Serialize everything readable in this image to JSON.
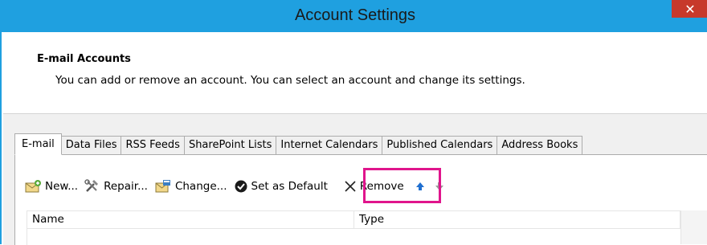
{
  "window": {
    "title": "Account Settings",
    "close_label": "✕"
  },
  "header": {
    "section_title": "E-mail Accounts",
    "description": "You can add or remove an account. You can select an account and change its settings."
  },
  "tabs": [
    {
      "label": "E-mail",
      "active": true
    },
    {
      "label": "Data Files",
      "active": false
    },
    {
      "label": "RSS Feeds",
      "active": false
    },
    {
      "label": "SharePoint Lists",
      "active": false
    },
    {
      "label": "Internet Calendars",
      "active": false
    },
    {
      "label": "Published Calendars",
      "active": false
    },
    {
      "label": "Address Books",
      "active": false
    }
  ],
  "toolbar": {
    "new_label": "New...",
    "repair_label": "Repair...",
    "change_label": "Change...",
    "set_default_label": "Set as Default",
    "remove_label": "Remove",
    "highlight_color": "#e0158c"
  },
  "list": {
    "columns": [
      "Name",
      "Type"
    ]
  },
  "colors": {
    "titlebar": "#1fa0e0",
    "close": "#c7392b"
  }
}
